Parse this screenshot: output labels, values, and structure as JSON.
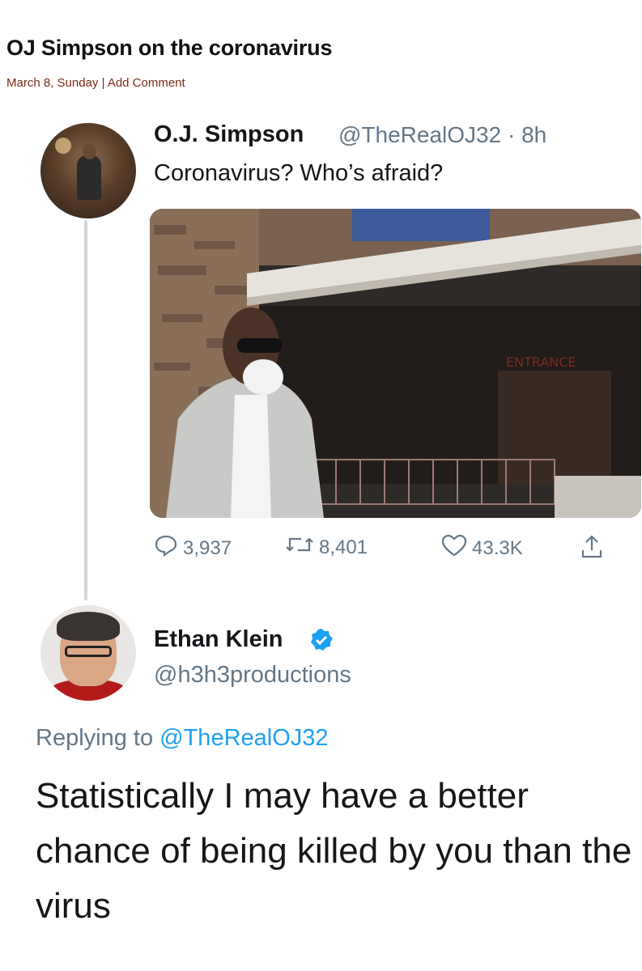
{
  "article": {
    "title": "OJ Simpson on the coronavirus",
    "date": "March 8, Sunday",
    "separator": "|",
    "comment_link": "Add Comment"
  },
  "tweet": {
    "name": "O.J. Simpson",
    "handle_time": "@TheRealOJ32 · 8h",
    "text": "Coronavirus? Who’s afraid?",
    "actions": {
      "replies": "3,937",
      "retweets": "8,401",
      "likes": "43.3K"
    }
  },
  "reply": {
    "name": "Ethan Klein",
    "handle": "@h3h3productions",
    "replying_prefix": "Replying to",
    "replying_to": "@TheRealOJ32",
    "text": "Statistically I may have a better chance of being killed by you than the virus"
  },
  "colors": {
    "link_blue": "#1da1f2",
    "meta_text": "#657786",
    "date_color": "#7a2a1a"
  },
  "icons": [
    "reply-icon",
    "retweet-icon",
    "like-icon",
    "share-icon",
    "verified-badge-icon"
  ]
}
